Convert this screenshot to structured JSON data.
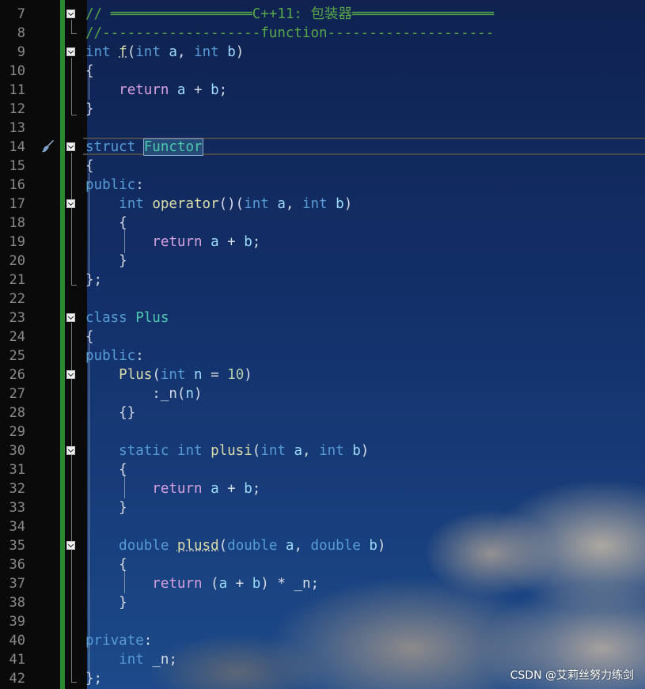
{
  "editor": {
    "line_numbers": [
      "7",
      "8",
      "9",
      "10",
      "11",
      "12",
      "13",
      "14",
      "15",
      "16",
      "17",
      "18",
      "19",
      "20",
      "21",
      "22",
      "23",
      "24",
      "25",
      "26",
      "27",
      "28",
      "29",
      "30",
      "31",
      "32",
      "33",
      "34",
      "35",
      "36",
      "37",
      "38",
      "39",
      "40",
      "41",
      "42"
    ],
    "tokens": {
      "t7a": "// ═════════════════",
      "t7b": "C++11: 包装器",
      "t7c": "═════════════════",
      "t8": "//-------------------function--------------------",
      "kw_int": "int",
      "fn_f": "f",
      "p_a": "a",
      "p_b": "b",
      "kw_return": "return",
      "kw_struct": "struct",
      "ty_functor": "Functor",
      "kw_public": "public",
      "fn_operator": "operator",
      "kw_class": "class",
      "ty_plus": "Plus",
      "p_n": "n",
      "num_10": "10",
      "member_n": "_n",
      "kw_static": "static",
      "fn_plusi": "plusi",
      "kw_double": "double",
      "fn_plusd": "plusd",
      "kw_private": "private"
    }
  },
  "watermark": "CSDN @艾莉丝努力练剑",
  "icons": {
    "gutter": "paintbrush-icon",
    "fold": "collapse-box-icon"
  }
}
